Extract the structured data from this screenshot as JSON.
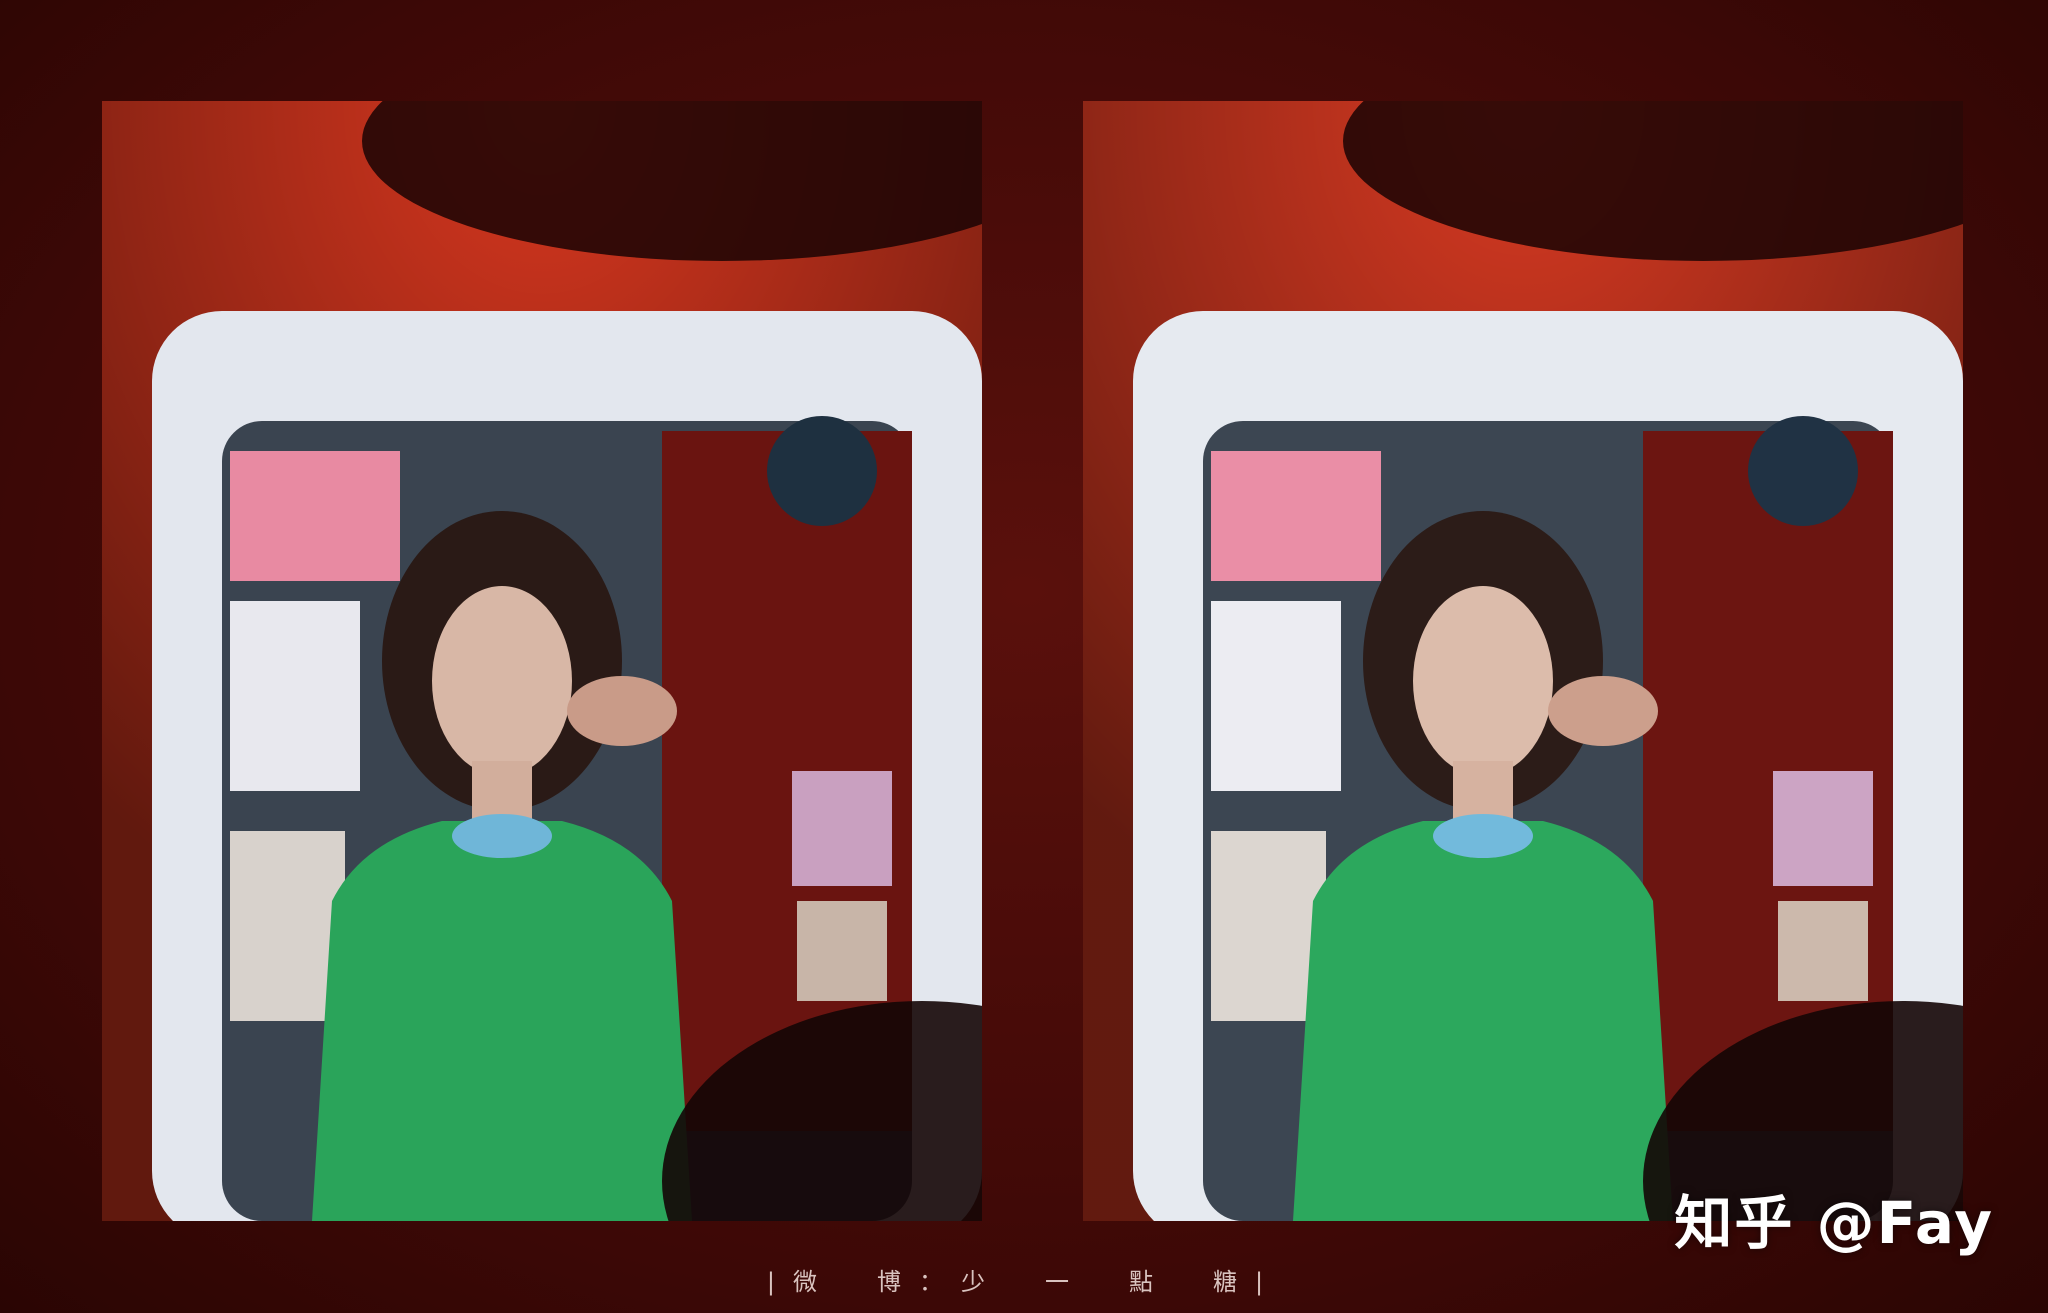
{
  "photos": [
    {
      "id": "left",
      "variant": "original"
    },
    {
      "id": "right",
      "variant": "edited"
    }
  ],
  "caption": "|微　博：少　一　點　糖|",
  "watermark": "知乎 @Fay",
  "colors": {
    "background": "#4a0d0a",
    "wall_red": "#d8371f",
    "mirror_frame": "#e6eaf0",
    "dress_green": "#2aa45a",
    "caption_text": "#d9c3bf",
    "watermark_text": "#ffffff"
  }
}
